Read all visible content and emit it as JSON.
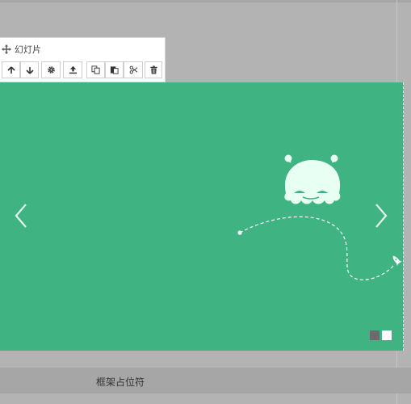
{
  "panel": {
    "title": "幻灯片",
    "toolbar": [
      {
        "name": "move-up-button",
        "icon": "arrow-up-icon"
      },
      {
        "name": "move-down-button",
        "icon": "arrow-down-icon"
      },
      {
        "name": "settings-button",
        "icon": "gear-icon"
      },
      {
        "name": "upload-button",
        "icon": "upload-icon"
      },
      {
        "name": "copy-button",
        "icon": "copy-icon"
      },
      {
        "name": "paste-button",
        "icon": "paste-icon"
      },
      {
        "name": "cut-button",
        "icon": "scissors-icon"
      },
      {
        "name": "delete-button",
        "icon": "trash-icon"
      }
    ]
  },
  "slider": {
    "background": "#3fb382",
    "slide_count": 2,
    "active_slide": 2
  },
  "footer": {
    "label": "框架占位符"
  }
}
